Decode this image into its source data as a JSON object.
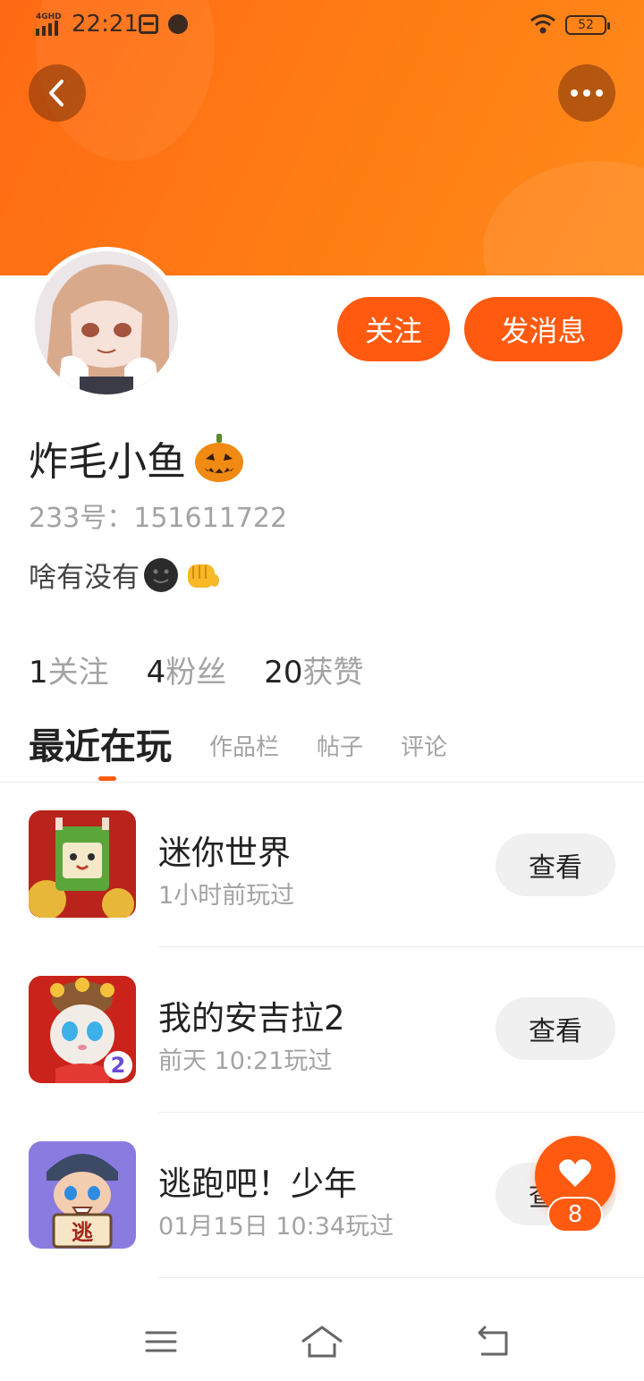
{
  "status_bar": {
    "network": "4GHD",
    "time": "22:21",
    "battery": "52"
  },
  "header": {
    "back_icon": "chevron-left-icon",
    "more_icon": "more-dots-icon",
    "follow_label": "关注",
    "message_label": "发消息"
  },
  "profile": {
    "name": "炸毛小鱼",
    "name_emoji": "pumpkin",
    "id_text": "233号：151611722",
    "bio": "啥有没有",
    "bio_emojis": [
      "dark-smiley",
      "fist-bump"
    ]
  },
  "stats": [
    {
      "num": "1",
      "label": "关注"
    },
    {
      "num": "4",
      "label": "粉丝"
    },
    {
      "num": "20",
      "label": "获赞"
    }
  ],
  "tabs": [
    {
      "label": "最近在玩",
      "active": true
    },
    {
      "label": "作品栏",
      "active": false
    },
    {
      "label": "帖子",
      "active": false
    },
    {
      "label": "评论",
      "active": false
    }
  ],
  "games": [
    {
      "name": "迷你世界",
      "time": "1小时前玩过",
      "action": "查看",
      "icon": "mini-world-icon"
    },
    {
      "name": "我的安吉拉2",
      "time": "前天 10:21玩过",
      "action": "查看",
      "icon": "angela-icon"
    },
    {
      "name": "逃跑吧！少年",
      "time": "01月15日 10:34玩过",
      "action": "查看",
      "icon": "escape-boy-icon"
    }
  ],
  "fab": {
    "icon": "heart-icon",
    "count": "8"
  },
  "nav": {
    "menu_icon": "menu-icon",
    "home_icon": "home-icon",
    "back_icon": "back-icon"
  },
  "colors": {
    "accent": "#ff5a10",
    "banner": "#ff7a14",
    "muted": "#a3a3a3"
  }
}
